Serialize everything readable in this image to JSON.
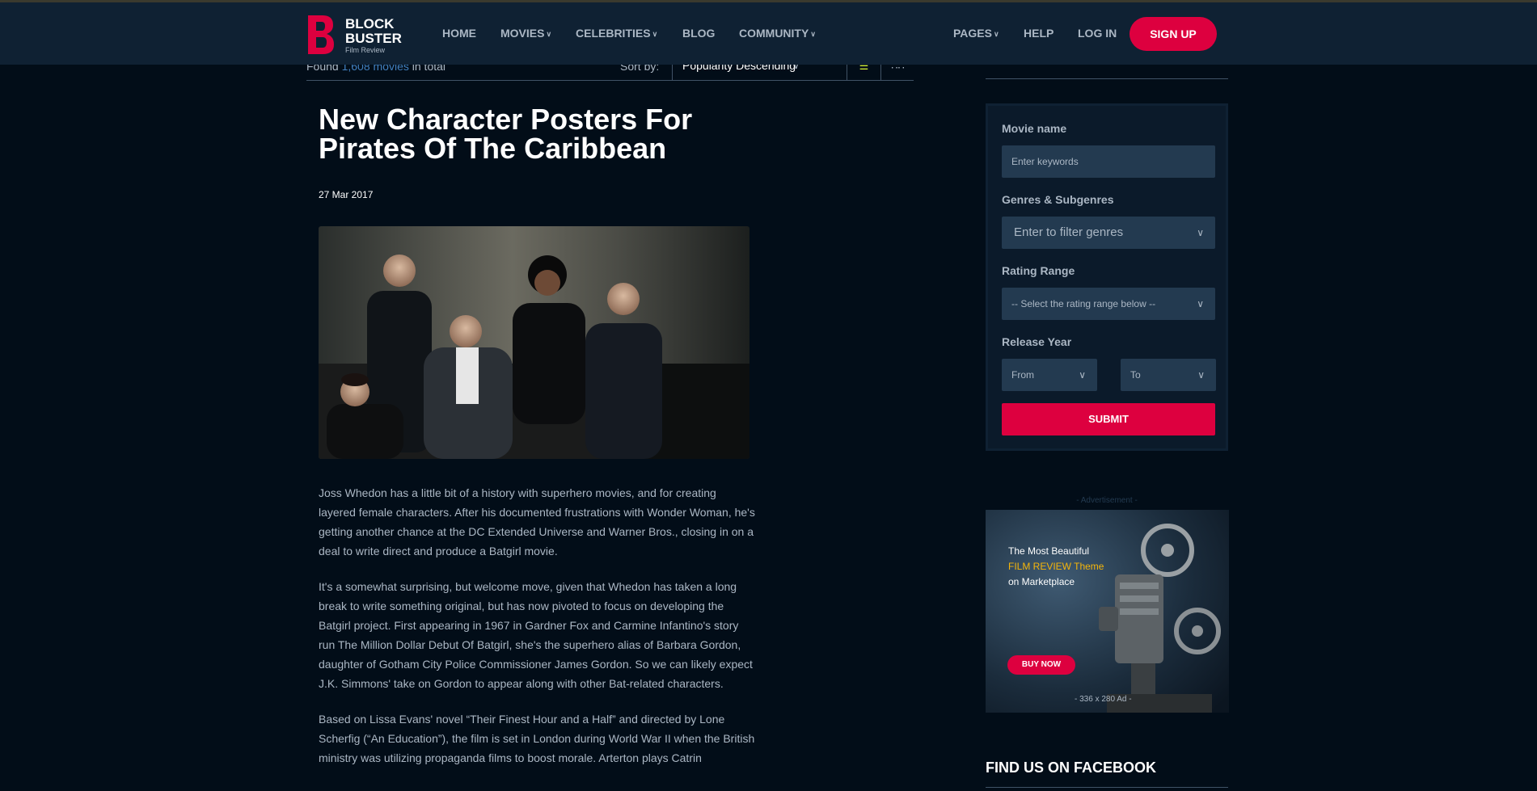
{
  "brand": {
    "line1": "BLOCK",
    "line2": "BUSTER",
    "sub": "Film Review"
  },
  "nav": {
    "home": "HOME",
    "movies": "MOVIES",
    "celebrities": "CELEBRITIES",
    "blog": "BLOG",
    "community": "COMMUNITY",
    "pages": "PAGES",
    "help": "HELP",
    "login": "LOG IN",
    "signup": "SIGN UP"
  },
  "listing": {
    "found_prefix": "Found",
    "found_count": "1,608 movies",
    "found_suffix": "in total",
    "sort_label": "Sort by:",
    "sort_value": "Popularity Descending"
  },
  "article": {
    "title": "New Character Posters For Pirates Of The Caribbean",
    "date": "27 Mar 2017",
    "paragraphs": [
      "Joss Whedon has a little bit of a history with superhero movies, and for creating layered female characters. After his documented frustrations with Wonder Woman, he's getting another chance at the DC Extended Universe and Warner Bros., closing in on a deal to write direct and produce a Batgirl movie.",
      "It's a somewhat surprising, but welcome move, given that Whedon has taken a long break to write something original, but has now pivoted to focus on developing the Batgirl project. First appearing in 1967 in Gardner Fox and Carmine Infantino's story run The Million Dollar Debut Of Batgirl, she's the superhero alias of Barbara Gordon, daughter of Gotham City Police Commissioner James Gordon. So we can likely expect J.K. Simmons' take on Gordon to appear along with other Bat-related characters.",
      "Based on Lissa Evans' novel “Their Finest Hour and a Half” and directed by Lone Scherfig (“An Education”), the film is set in London during World War II when the British ministry was utilizing propaganda films to boost morale. Arterton plays Catrin"
    ]
  },
  "search": {
    "movie_name_label": "Movie name",
    "movie_name_placeholder": "Enter keywords",
    "genres_label": "Genres & Subgenres",
    "genres_placeholder": "Enter to filter genres",
    "rating_label": "Rating Range",
    "rating_value": "-- Select the rating range below --",
    "year_label": "Release Year",
    "year_from": "From",
    "year_to": "To",
    "submit": "SUBMIT"
  },
  "ad": {
    "label": "- Advertisement -",
    "line1": "The Most Beautiful",
    "line2": "FILM REVIEW Theme",
    "line3": "on Marketplace",
    "button": "BUY NOW",
    "size": "- 336 x 280 Ad -"
  },
  "facebook": {
    "title": "FIND US ON FACEBOOK"
  },
  "colors": {
    "accent": "#dd003f",
    "link": "#4280bf",
    "bg": "#020d18",
    "nav": "#0f2133",
    "yellow": "#dcf836"
  }
}
